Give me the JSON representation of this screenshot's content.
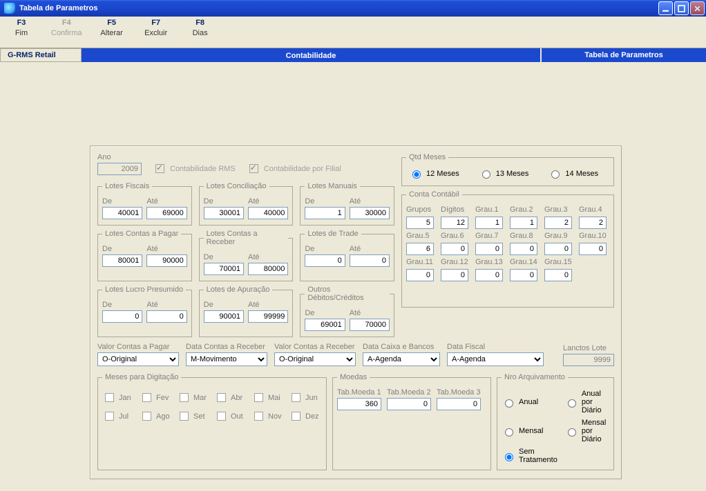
{
  "window": {
    "title": "Tabela de Parametros"
  },
  "toolbar": [
    {
      "key": "F3",
      "name": "Fim",
      "disabled": false
    },
    {
      "key": "F4",
      "name": "Confirma",
      "disabled": true
    },
    {
      "key": "F5",
      "name": "Alterar",
      "disabled": false
    },
    {
      "key": "F7",
      "name": "Excluir",
      "disabled": false
    },
    {
      "key": "F8",
      "name": "Dias",
      "disabled": false
    }
  ],
  "subheader": {
    "left": "G-RMS Retail",
    "mid": "Contabilidade",
    "right": "Tabela de Parametros"
  },
  "ano": {
    "label": "Ano",
    "value": "2009"
  },
  "checks": {
    "rms": "Contabilidade RMS",
    "filial": "Contabilidade por Filial"
  },
  "qtd_meses": {
    "legend": "Qtd Meses",
    "opt12": "12 Meses",
    "opt13": "13 Meses",
    "opt14": "14 Meses",
    "selected": "12"
  },
  "de_label": "De",
  "ate_label": "Até",
  "lotes": {
    "fiscais": {
      "legend": "Lotes Fiscais",
      "de": "40001",
      "ate": "69000"
    },
    "conciliacao": {
      "legend": "Lotes Conciliação",
      "de": "30001",
      "ate": "40000"
    },
    "manuais": {
      "legend": "Lotes Manuais",
      "de": "1",
      "ate": "30000"
    },
    "pagar": {
      "legend": "Lotes Contas a Pagar",
      "de": "80001",
      "ate": "90000"
    },
    "receber": {
      "legend": "Lotes Contas a Receber",
      "de": "70001",
      "ate": "80000"
    },
    "trade": {
      "legend": "Lotes de Trade",
      "de": "0",
      "ate": "0"
    },
    "lucro": {
      "legend": "Lotes Lucro Presumido",
      "de": "0",
      "ate": "0"
    },
    "apuracao": {
      "legend": "Lotes de Apuração",
      "de": "90001",
      "ate": "99999"
    },
    "outros": {
      "legend": "Outros Débitos/Créditos",
      "de": "69001",
      "ate": "70000"
    }
  },
  "conta": {
    "legend": "Conta Contábil",
    "labels": {
      "grupos": "Grupos",
      "digitos": "Dígitos",
      "g1": "Grau.1",
      "g2": "Grau.2",
      "g3": "Grau.3",
      "g4": "Grau.4",
      "g5": "Grau.5",
      "g6": "Grau.6",
      "g7": "Grau.7",
      "g8": "Grau.8",
      "g9": "Grau.9",
      "g10": "Grau.10",
      "g11": "Grau.11",
      "g12": "Grau.12",
      "g13": "Grau.13",
      "g14": "Grau.14",
      "g15": "Grau.15"
    },
    "values": {
      "grupos": "5",
      "digitos": "12",
      "g1": "1",
      "g2": "1",
      "g3": "2",
      "g4": "2",
      "g5": "6",
      "g6": "0",
      "g7": "0",
      "g8": "0",
      "g9": "0",
      "g10": "0",
      "g11": "0",
      "g12": "0",
      "g13": "0",
      "g14": "0",
      "g15": "0"
    }
  },
  "selects": {
    "vcp": {
      "label": "Valor Contas a Pagar",
      "value": "O-Original"
    },
    "dcr": {
      "label": "Data Contas a Receber",
      "value": "M-Movimento"
    },
    "vcr": {
      "label": "Valor Contas a Receber",
      "value": "O-Original"
    },
    "dcb": {
      "label": "Data Caixa e Bancos",
      "value": "A-Agenda"
    },
    "df": {
      "label": "Data Fiscal",
      "value": "A-Agenda"
    },
    "ll": {
      "label": "Lanctos Lote",
      "value": "9999"
    }
  },
  "meses": {
    "legend": "Meses para Digitação",
    "labels": {
      "jan": "Jan",
      "fev": "Fev",
      "mar": "Mar",
      "abr": "Abr",
      "mai": "Mai",
      "jun": "Jun",
      "jul": "Jul",
      "ago": "Ago",
      "set": "Set",
      "out": "Out",
      "nov": "Nov",
      "dez": "Dez"
    }
  },
  "moedas": {
    "legend": "Moedas",
    "t1": {
      "label": "Tab.Moeda 1",
      "value": "360"
    },
    "t2": {
      "label": "Tab.Moeda 2",
      "value": "0"
    },
    "t3": {
      "label": "Tab.Moeda 3",
      "value": "0"
    }
  },
  "arq": {
    "legend": "Nro Arquivamento",
    "anual": "Anual",
    "anuald": "Anual por Diário",
    "mensal": "Mensal",
    "mensald": "Mensal por Diário",
    "sem": "Sem Tratamento",
    "selected": "sem"
  }
}
